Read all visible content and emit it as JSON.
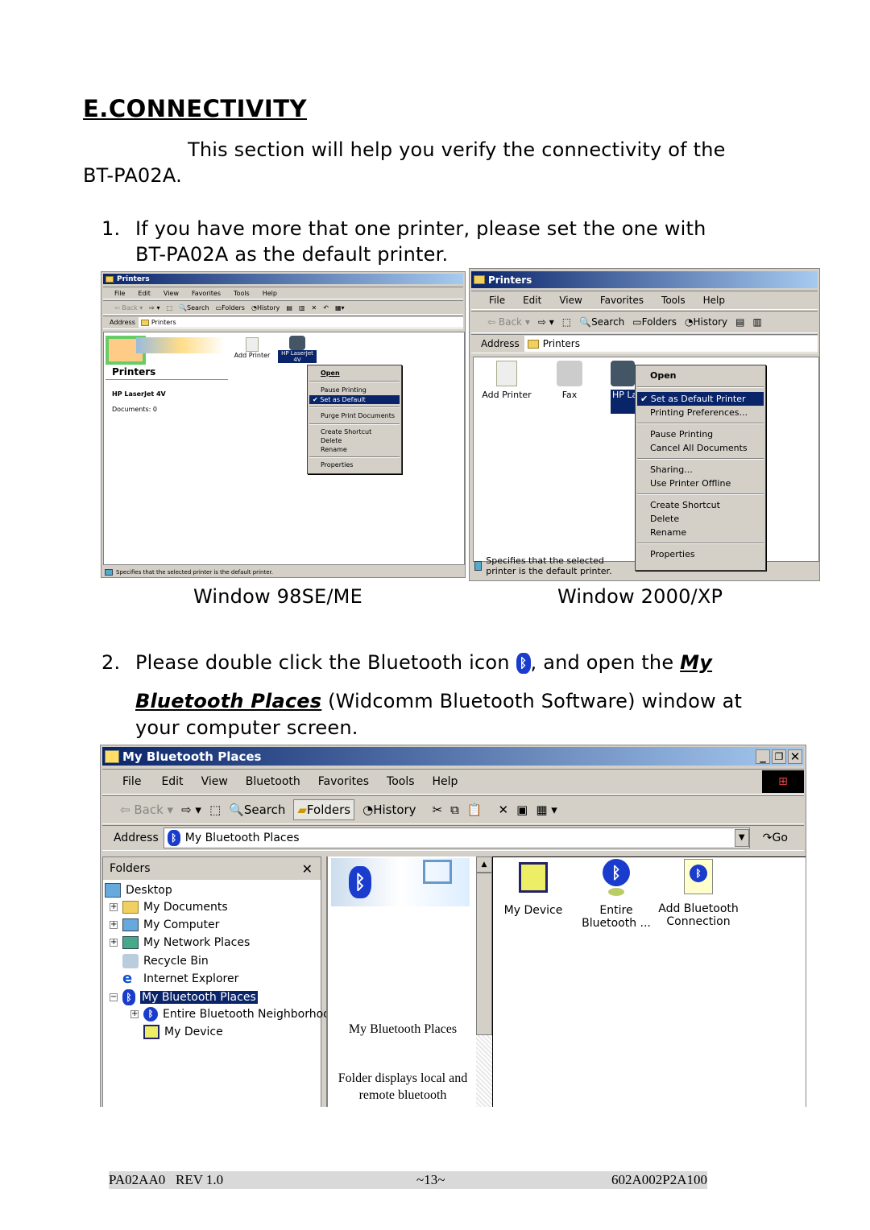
{
  "heading": "E.CONNECTIVITY",
  "intro": {
    "line1": "This section will help you verify the connectivity of the",
    "line2": "BT-PA02A."
  },
  "step1": {
    "number": "1.",
    "line1": "If you have more that one printer, please set the one with",
    "line2": "BT-PA02A as the default printer."
  },
  "captions": {
    "win98": "Window 98SE/ME",
    "win2000": "Window 2000/XP"
  },
  "step2": {
    "number": "2.",
    "line1_a": "Please double click the Bluetooth icon",
    "line1_b": ", and open the",
    "link_part1": "My",
    "link_part2": "Bluetooth Places",
    "line2_rest": " (Widcomm Bluetooth Software) window at",
    "line3": "your computer screen."
  },
  "win98": {
    "title": "Printers",
    "menu": [
      "File",
      "Edit",
      "View",
      "Favorites",
      "Tools",
      "Help"
    ],
    "toolbar": {
      "back": "Back",
      "search": "Search",
      "folders": "Folders",
      "history": "History"
    },
    "address_label": "Address",
    "address_value": "Printers",
    "panel_title": "Printers",
    "printer_name": "HP LaserJet 4V",
    "documents": "Documents: 0",
    "icons": [
      "Add Printer",
      "HP LaserJet 4V"
    ],
    "context_menu": [
      "Open",
      "Pause Printing",
      "Set as Default",
      "Purge Print Documents",
      "Create Shortcut",
      "Delete",
      "Rename",
      "Properties"
    ],
    "status": "Specifies that the selected printer is the default printer."
  },
  "win2000": {
    "title": "Printers",
    "menu": [
      "File",
      "Edit",
      "View",
      "Favorites",
      "Tools",
      "Help"
    ],
    "toolbar": {
      "back": "Back",
      "search": "Search",
      "folders": "Folders",
      "history": "History"
    },
    "address_label": "Address",
    "address_value": "Printers",
    "icons": [
      "Add Printer",
      "Fax",
      "HP La"
    ],
    "context_menu": [
      "Open",
      "Set as Default Printer",
      "Printing Preferences...",
      "Pause Printing",
      "Cancel All Documents",
      "Sharing...",
      "Use Printer Offline",
      "Create Shortcut",
      "Delete",
      "Rename",
      "Properties"
    ],
    "status": "Specifies that the selected printer is the default printer."
  },
  "btwin": {
    "title": "My Bluetooth Places",
    "menu": [
      "File",
      "Edit",
      "View",
      "Bluetooth",
      "Favorites",
      "Tools",
      "Help"
    ],
    "toolbar": {
      "back": "Back",
      "search": "Search",
      "folders": "Folders",
      "history": "History"
    },
    "address_label": "Address",
    "address_value": "My Bluetooth Places",
    "go": "Go",
    "folders_title": "Folders",
    "tree": [
      "Desktop",
      "My Documents",
      "My Computer",
      "My Network Places",
      "Recycle Bin",
      "Internet Explorer",
      "My Bluetooth Places",
      "Entire Bluetooth Neighborhood",
      "My Device"
    ],
    "webview_title": "My Bluetooth Places",
    "webview_desc_1": "Folder displays local and",
    "webview_desc_2": "remote bluetooth",
    "icons": [
      {
        "line1": "My Device",
        "line2": ""
      },
      {
        "line1": "Entire",
        "line2": "Bluetooth ..."
      },
      {
        "line1": "Add Bluetooth",
        "line2": "Connection"
      }
    ],
    "selection_color": "#0a246a"
  },
  "footer": {
    "left": "PA02AA0   REV 1.0",
    "center": "~13~",
    "right": "602A002P2A100"
  }
}
